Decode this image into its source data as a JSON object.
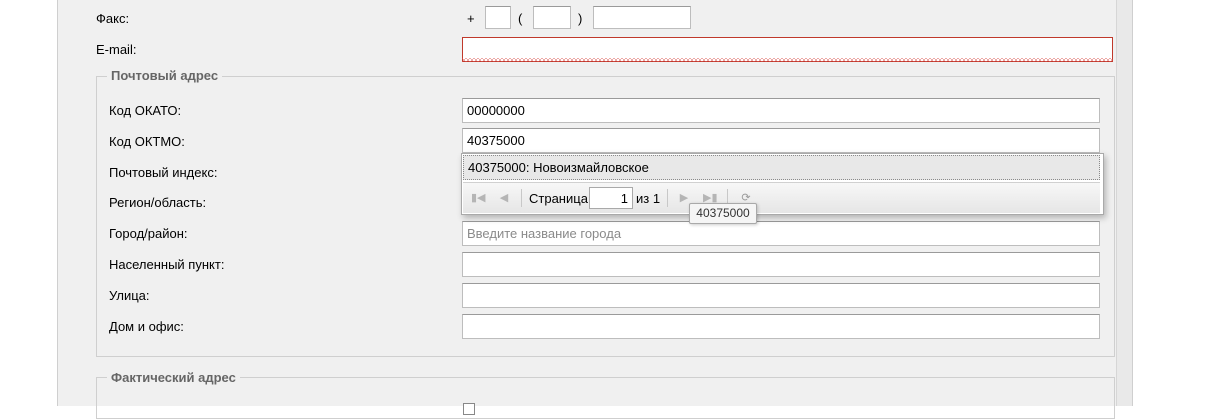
{
  "contact": {
    "fax_label": "Факс:",
    "fax_plus": "+",
    "fax_open_paren": "(",
    "fax_close_paren": ")",
    "email_label": "E-mail:"
  },
  "postal": {
    "legend": "Почтовый адрес",
    "okato_label": "Код ОКАТО:",
    "okato_value": "00000000",
    "oktmo_label": "Код ОКТМО:",
    "oktmo_value": "40375000",
    "index_label": "Почтовый индекс:",
    "region_label": "Регион/область:",
    "city_label": "Город/район:",
    "city_placeholder": "Введите название города",
    "settlement_label": "Населенный пункт:",
    "street_label": "Улица:",
    "house_label": "Дом и офис:"
  },
  "dropdown": {
    "item": "40375000: Новоизмайловское",
    "page_label": "Страница",
    "page_value": "1",
    "page_of": "из 1",
    "tooltip": "40375000"
  },
  "actual": {
    "legend": "Фактический адрес"
  }
}
